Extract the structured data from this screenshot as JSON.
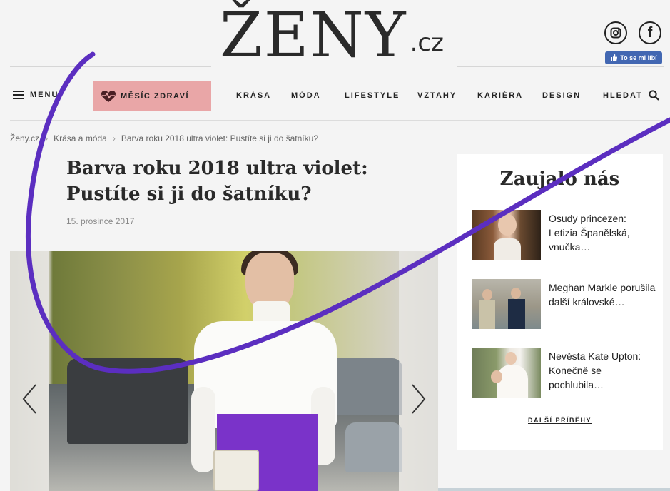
{
  "header": {
    "logo_main": "ŽENY",
    "logo_tld": ".cz",
    "like_label": "To se mi líbí"
  },
  "nav": {
    "menu_label": "MENU",
    "health_label": "MĚSÍC ZDRAVÍ",
    "items": [
      "KRÁSA",
      "MÓDA",
      "LIFESTYLE",
      "VZTAHY",
      "KARIÉRA",
      "DESIGN"
    ],
    "search_label": "HLEDAT"
  },
  "breadcrumb": {
    "items": [
      "Ženy.cz",
      "Krása a móda",
      "Barva roku 2018 ultra violet: Pustíte si ji do šatníku?"
    ]
  },
  "article": {
    "title": "Barva roku 2018 ultra violet: Pustíte si ji do šatníku?",
    "date": "15. prosince 2017"
  },
  "sidebar": {
    "title": "Zaujalo nás",
    "items": [
      {
        "text": "Osudy princezen: Letizia Španělská, vnučka…"
      },
      {
        "text": "Meghan Markle porušila další královské…"
      },
      {
        "text": "Nevěsta Kate Upton: Konečně se pochlubila…"
      }
    ],
    "more_label": "DALŠÍ PŘÍBĚHY"
  },
  "colors": {
    "health_bg": "#e9a6a7",
    "stroke": "#5b2ec0",
    "facebook": "#4267b2",
    "skirt": "#7a33c9"
  },
  "icons": {
    "instagram": "instagram-icon",
    "facebook": "facebook-icon",
    "hamburger": "hamburger-icon",
    "heartbeat": "heartbeat-icon",
    "search": "search-icon",
    "prev": "chevron-left-icon",
    "next": "chevron-right-icon"
  }
}
